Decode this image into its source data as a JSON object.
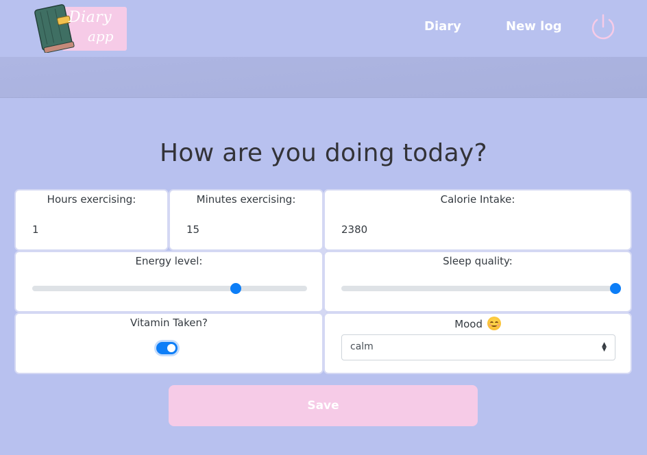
{
  "app": {
    "logo_line1": "Diary",
    "logo_line2": "app"
  },
  "nav": {
    "items": [
      {
        "label": "Diary"
      },
      {
        "label": "New log"
      }
    ],
    "power_icon": "power-icon"
  },
  "page": {
    "title": "How are you doing today?"
  },
  "form": {
    "hours": {
      "label": "Hours exercising:",
      "value": "1"
    },
    "minutes": {
      "label": "Minutes exercising:",
      "value": "15"
    },
    "calories": {
      "label": "Calorie Intake:",
      "value": "2380"
    },
    "energy": {
      "label": "Energy level:",
      "fraction": 0.74
    },
    "sleep": {
      "label": "Sleep quality:",
      "fraction": 1.0
    },
    "vitamin": {
      "label": "Vitamin Taken?",
      "checked": true
    },
    "mood": {
      "label": "Mood",
      "emoji_icon": "smiling-face-icon",
      "selected": "calm"
    },
    "save_label": "Save"
  },
  "colors": {
    "background": "#b8c1ef",
    "accent_pink": "#f6cbe7",
    "control_blue": "#0d7ef7"
  }
}
